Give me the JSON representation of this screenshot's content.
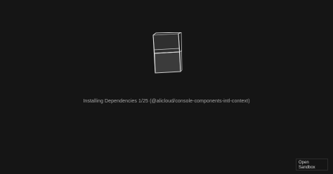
{
  "loader": {
    "icon": "sandbox-cube-icon",
    "status": "Installing Dependencies 1/25 (@alicloud/console-components-intl-context)"
  },
  "actions": {
    "open_sandbox_line1": "Open",
    "open_sandbox_line2": "Sandbox"
  },
  "colors": {
    "background": "#151515",
    "cube_stroke": "#d8d8d8",
    "cube_fill": "#3a3a3a",
    "text": "#a8a8a8"
  }
}
